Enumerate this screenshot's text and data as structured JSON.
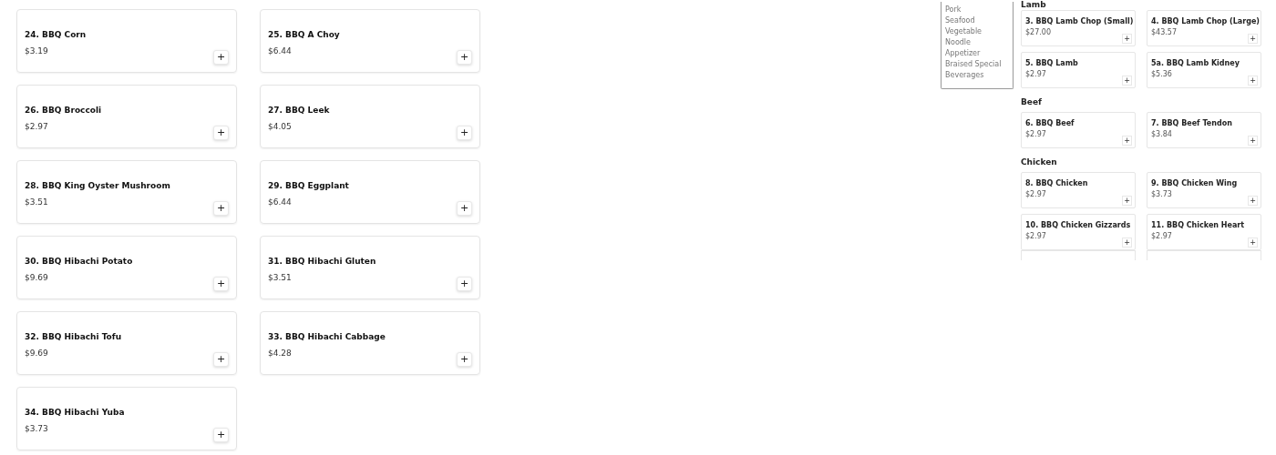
{
  "menu_items": [
    {
      "name": "24. BBQ Corn",
      "price": "$3.19",
      "add": "+"
    },
    {
      "name": "25. BBQ A Choy",
      "price": "$6.44",
      "add": "+"
    },
    {
      "name": "26. BBQ Broccoli",
      "price": "$2.97",
      "add": "+"
    },
    {
      "name": "27. BBQ Leek",
      "price": "$4.05",
      "add": "+"
    },
    {
      "name": "28. BBQ King Oyster Mushroom",
      "price": "$3.51",
      "add": "+"
    },
    {
      "name": "29. BBQ Eggplant",
      "price": "$6.44",
      "add": "+"
    },
    {
      "name": "30. BBQ Hibachi Potato",
      "price": "$9.69",
      "add": "+"
    },
    {
      "name": "31. BBQ Hibachi Gluten",
      "price": "$3.51",
      "add": "+"
    },
    {
      "name": "32. BBQ Hibachi Tofu",
      "price": "$9.69",
      "add": "+"
    },
    {
      "name": "33. BBQ Hibachi Cabbage",
      "price": "$4.28",
      "add": "+"
    },
    {
      "name": "34. BBQ Hibachi Yuba",
      "price": "$3.73",
      "add": "+"
    }
  ],
  "preview": {
    "sidebar_items": [
      "Pork",
      "Seafood",
      "Vegetable",
      "Noodle",
      "Appetizer",
      "Braised Special",
      "Beverages"
    ],
    "sections": [
      {
        "title": "Lamb",
        "items": [
          {
            "name": "3. BBQ Lamb Chop (Small)",
            "price": "$27.00",
            "add": "+"
          },
          {
            "name": "4. BBQ Lamb Chop (Large)",
            "price": "$43.57",
            "add": "+"
          },
          {
            "name": "5. BBQ Lamb",
            "price": "$2.97",
            "add": "+"
          },
          {
            "name": "5a. BBQ Lamb Kidney",
            "price": "$5.36",
            "add": "+"
          }
        ]
      },
      {
        "title": "Beef",
        "items": [
          {
            "name": "6. BBQ Beef",
            "price": "$2.97",
            "add": "+"
          },
          {
            "name": "7. BBQ Beef Tendon",
            "price": "$3.84",
            "add": "+"
          }
        ]
      },
      {
        "title": "Chicken",
        "items": [
          {
            "name": "8. BBQ Chicken",
            "price": "$2.97",
            "add": "+"
          },
          {
            "name": "9. BBQ Chicken Wing",
            "price": "$3.73",
            "add": "+"
          },
          {
            "name": "10. BBQ Chicken Gizzards",
            "price": "$2.97",
            "add": "+"
          },
          {
            "name": "11. BBQ Chicken Heart",
            "price": "$2.97",
            "add": "+"
          }
        ]
      }
    ]
  }
}
